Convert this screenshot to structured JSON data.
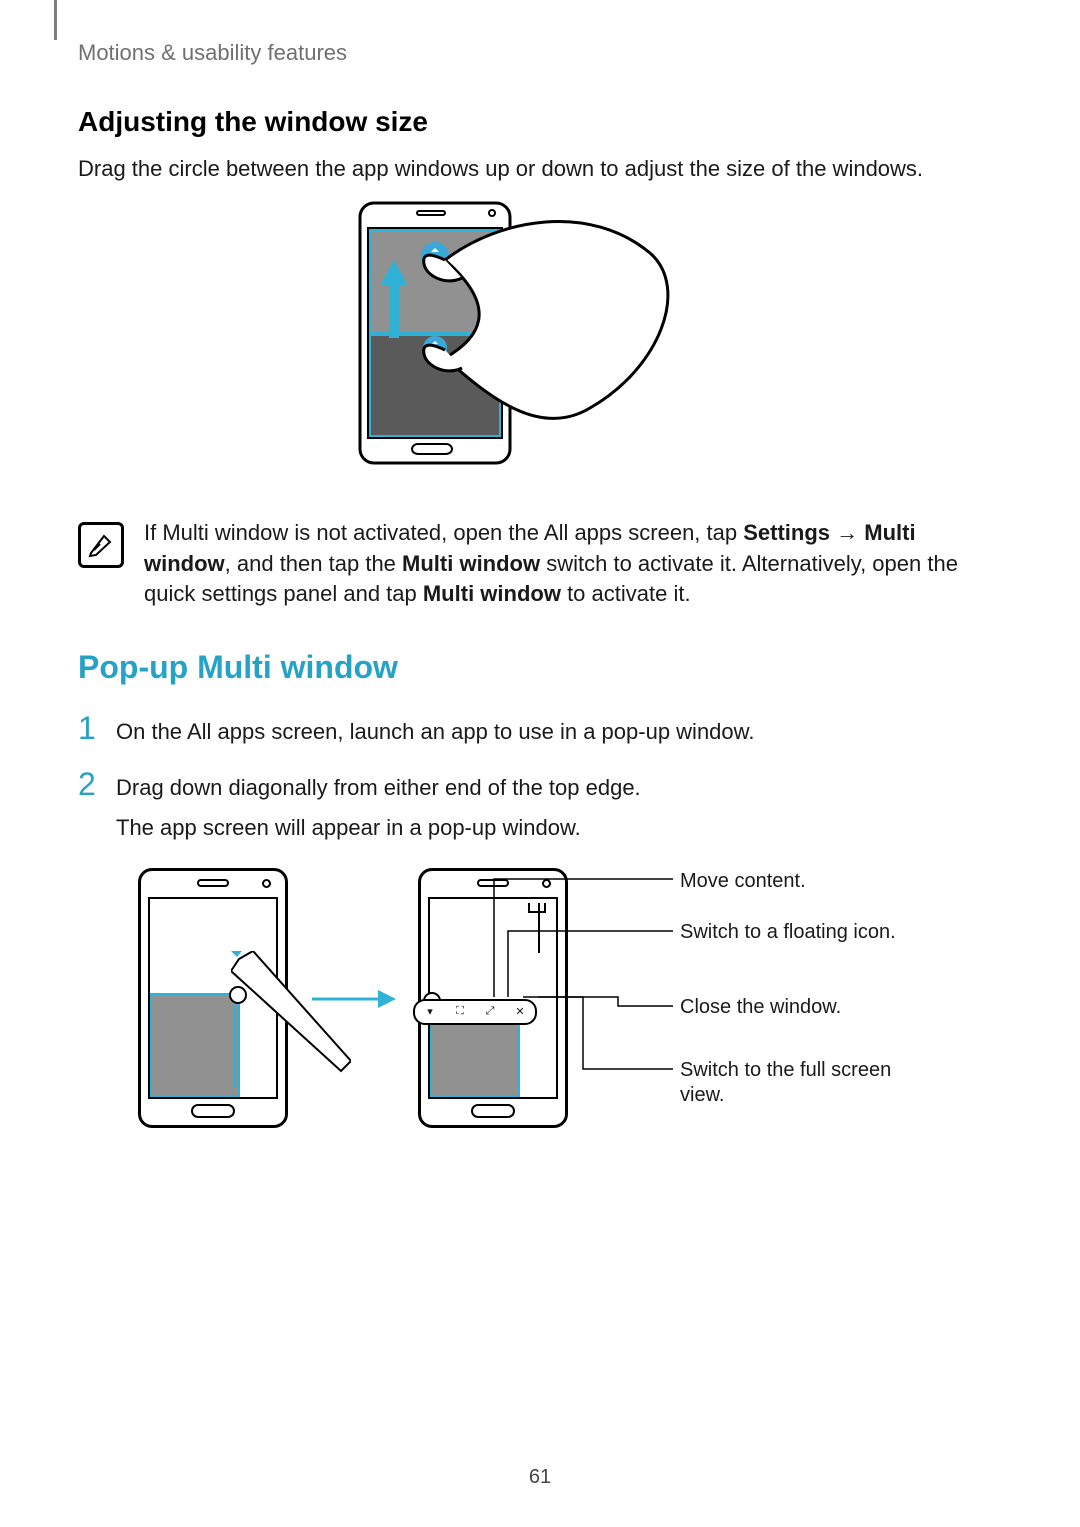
{
  "breadcrumb": "Motions & usability features",
  "section1": {
    "heading": "Adjusting the window size",
    "body": "Drag the circle between the app windows up or down to adjust the size of the windows."
  },
  "note": {
    "pre": "If Multi window is not activated, open the All apps screen, tap ",
    "b1": "Settings",
    "arrow": " → ",
    "b2": "Multi window",
    "mid1": ", and then tap the ",
    "b3": "Multi window",
    "mid2": " switch to activate it. Alternatively, open the quick settings panel and tap ",
    "b4": "Multi window",
    "post": " to activate it."
  },
  "section2": {
    "heading": "Pop-up Multi window",
    "step1": "On the All apps screen, launch an app to use in a pop-up window.",
    "step2a": "Drag down diagonally from either end of the top edge.",
    "step2b": "The app screen will appear in a pop-up window.",
    "num1": "1",
    "num2": "2"
  },
  "callouts": {
    "c1": "Move content.",
    "c2": "Switch to a floating icon.",
    "c3": "Close the window.",
    "c4": "Switch to the full screen view."
  },
  "popup_bar_icons": {
    "i1": "▾",
    "i2": "⛶",
    "i3": "⤢",
    "i4": "✕"
  },
  "page_number": "61"
}
